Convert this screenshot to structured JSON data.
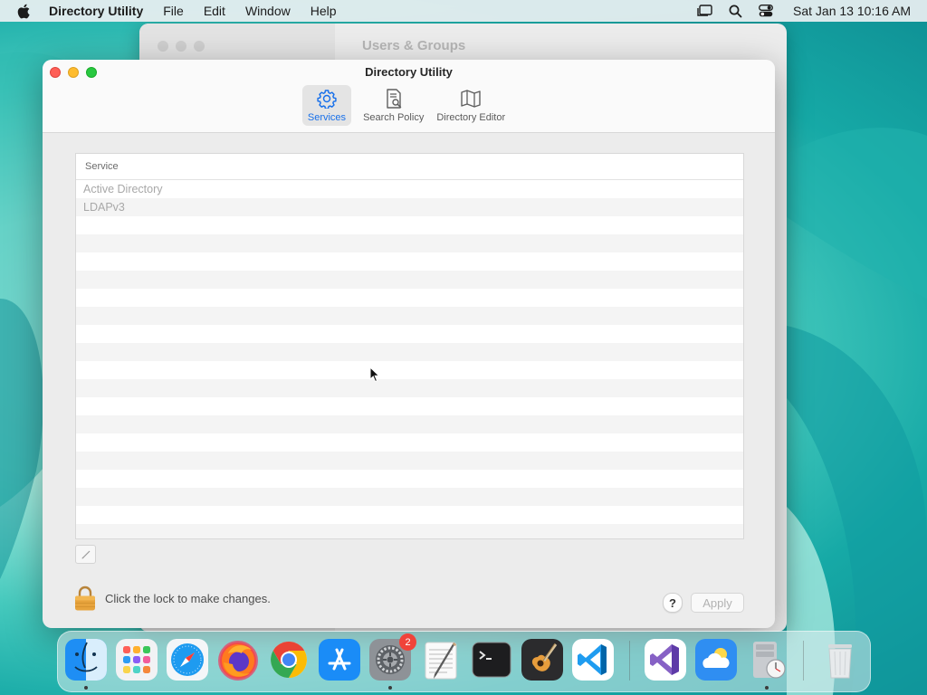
{
  "menubar": {
    "app_name": "Directory Utility",
    "items": [
      "File",
      "Edit",
      "Window",
      "Help"
    ],
    "clock": "Sat Jan 13  10:16 AM"
  },
  "background_window": {
    "title": "Users & Groups"
  },
  "window": {
    "title": "Directory Utility",
    "tabs": [
      {
        "label": "Services",
        "icon": "gear-icon",
        "active": true
      },
      {
        "label": "Search Policy",
        "icon": "search-document-icon",
        "active": false
      },
      {
        "label": "Directory Editor",
        "icon": "map-icon",
        "active": false
      }
    ],
    "table": {
      "header": "Service",
      "rows": [
        "Active Directory",
        "LDAPv3"
      ]
    },
    "lock_text": "Click the lock to make changes.",
    "help_label": "?",
    "apply_label": "Apply"
  },
  "dock": {
    "items": [
      {
        "name": "Finder",
        "icon": "finder-icon"
      },
      {
        "name": "Launchpad",
        "icon": "launchpad-icon"
      },
      {
        "name": "Safari",
        "icon": "safari-icon"
      },
      {
        "name": "Firefox",
        "icon": "firefox-icon"
      },
      {
        "name": "Chrome",
        "icon": "chrome-icon"
      },
      {
        "name": "App Store",
        "icon": "app-store-icon"
      },
      {
        "name": "System Settings",
        "icon": "system-settings-icon",
        "badge": "2"
      },
      {
        "name": "TextEdit",
        "icon": "textedit-icon"
      },
      {
        "name": "Terminal",
        "icon": "terminal-icon"
      },
      {
        "name": "GarageBand",
        "icon": "garageband-icon"
      },
      {
        "name": "Visual Studio Code",
        "icon": "vscode-icon"
      },
      {
        "name": "Visual Studio",
        "icon": "visual-studio-icon"
      },
      {
        "name": "Weather",
        "icon": "weather-icon"
      },
      {
        "name": "Directory Utility",
        "icon": "directory-utility-icon"
      },
      {
        "name": "Trash",
        "icon": "trash-icon"
      }
    ]
  },
  "colors": {
    "accent": "#1870ea",
    "close": "#fe5f57",
    "minimize": "#febc2e",
    "zoom": "#28c840",
    "badge": "#f0433a"
  }
}
